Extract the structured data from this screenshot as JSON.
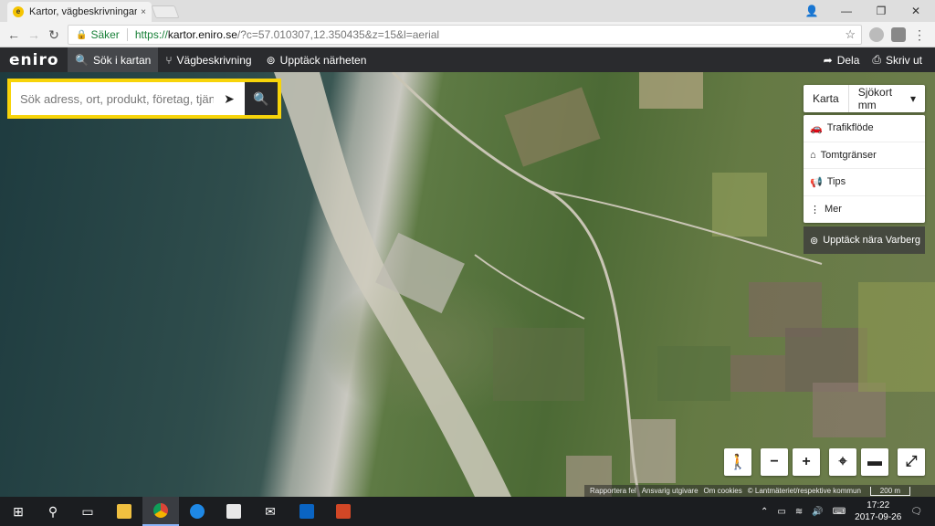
{
  "browser": {
    "tab_title": "Kartor, vägbeskrivningar",
    "tab_close": "×",
    "url_secure_label": "Säker",
    "url_protocol": "https://",
    "url_host": "kartor.eniro.se",
    "url_path": "/?c=57.010307,12.350435&z=15&l=aerial"
  },
  "app": {
    "logo": "eniro",
    "nav": [
      {
        "label": "Sök i kartan",
        "icon": "search-icon"
      },
      {
        "label": "Vägbeskrivning",
        "icon": "route-icon"
      },
      {
        "label": "Upptäck närheten",
        "icon": "binoculars-icon"
      }
    ],
    "share_label": "Dela",
    "print_label": "Skriv ut"
  },
  "search": {
    "placeholder": "Sök adress, ort, produkt, företag, tjänst"
  },
  "layers": {
    "map_label": "Karta",
    "sea_label": "Sjökort mm"
  },
  "menu": [
    {
      "label": "Trafikflöde",
      "icon": "car-icon"
    },
    {
      "label": "Tomtgränser",
      "icon": "property-icon"
    },
    {
      "label": "Tips",
      "icon": "megaphone-icon"
    },
    {
      "label": "Mer",
      "icon": "more-icon"
    }
  ],
  "discover_label": "Upptäck nära Varberg",
  "attribution": {
    "report": "Rapportera fel",
    "publisher": "Ansvarig utgivare",
    "cookies": "Om cookies",
    "copyright": "© Lantmäteriet/respektive kommun",
    "scale": "200 m"
  },
  "taskbar": {
    "time": "17:22",
    "date": "2017-09-26"
  },
  "colors": {
    "accent": "#f7d40a",
    "header": "#2a2b2e",
    "secure": "#188038"
  }
}
